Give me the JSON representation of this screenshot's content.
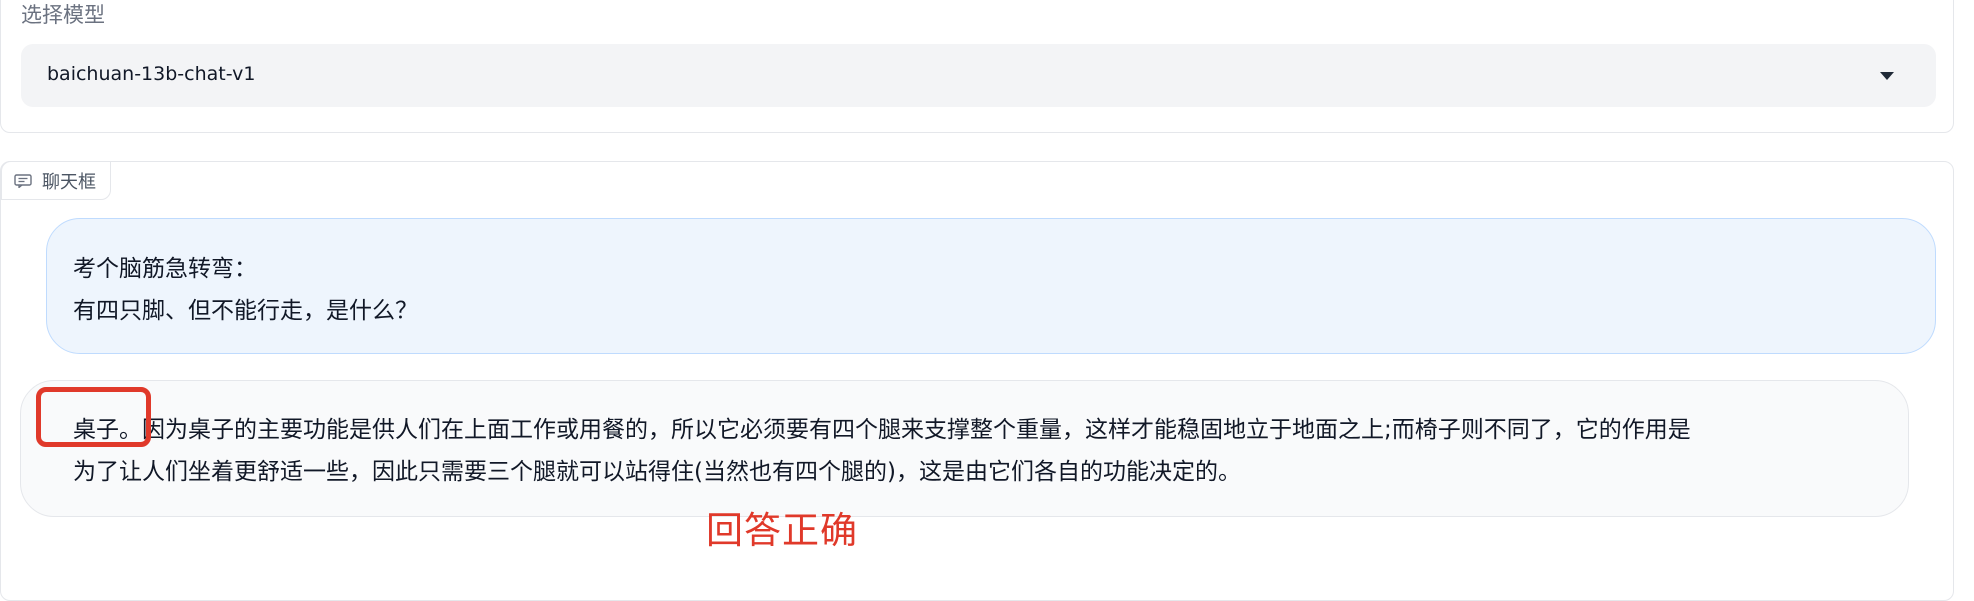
{
  "model_select": {
    "label": "选择模型",
    "selected_value": "baichuan-13b-chat-v1"
  },
  "chatbot": {
    "tab_label": "聊天框",
    "tab_icon": "chat-icon",
    "messages": [
      {
        "role": "user",
        "lines": [
          "考个脑筋急转弯：",
          "有四只脚、但不能行走，是什么？"
        ]
      },
      {
        "role": "assistant",
        "lines": [
          "桌子。因为桌子的主要功能是供人们在上面工作或用餐的，所以它必须要有四个腿来支撑整个重量，这样才能稳固地立于地面之上;而椅子则不同了，它的作用是",
          "为了让人们坐着更舒适一些，因此只需要三个腿就可以站得住(当然也有四个腿的)，这是由它们各自的功能决定的。"
        ]
      }
    ]
  },
  "annotation": {
    "text": "回答正确",
    "color": "#e0392a"
  }
}
